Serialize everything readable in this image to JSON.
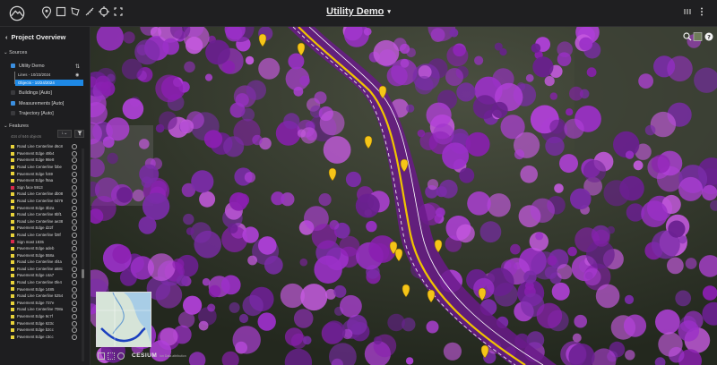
{
  "header": {
    "title": "Utility Demo",
    "caret": "▾",
    "tools": [
      "pin-icon",
      "square-icon",
      "polygon-icon",
      "ruler-icon",
      "crosshair-icon",
      "fullscreen-icon"
    ]
  },
  "sidebar": {
    "back": "‹",
    "project_title": "Project Overview",
    "sources_label": "Sources",
    "source": {
      "name": "Utility Demo",
      "children": [
        "Lines - 10/23/2024",
        "Objects - 10/24/2024"
      ]
    },
    "other_sources": [
      "Buildings [Auto]",
      "Measurements [Auto]",
      "Trajectory [Auto]"
    ],
    "features_label": "Features",
    "features_count": "434 of 646 objects",
    "features": [
      {
        "label": "Road Line Centerline d6c8",
        "color": "#e8d23a"
      },
      {
        "label": "Pavement Edge 49b4",
        "color": "#e8d23a"
      },
      {
        "label": "Pavement Edge 98e8",
        "color": "#e8d23a"
      },
      {
        "label": "Road Line Centerline f2be",
        "color": "#e8d23a"
      },
      {
        "label": "Pavement Edge fc69",
        "color": "#e8d23a"
      },
      {
        "label": "Pavement Edge f9aa",
        "color": "#e8d23a"
      },
      {
        "label": "Sign face 5913",
        "color": "#d9284d"
      },
      {
        "label": "Road Line Centerline db08",
        "color": "#e8d23a"
      },
      {
        "label": "Road Line Centerline 0d79",
        "color": "#e8d23a"
      },
      {
        "label": "Pavement Edge 3b2a",
        "color": "#e8d23a"
      },
      {
        "label": "Road Line Centerline 8bf1",
        "color": "#e8d23a"
      },
      {
        "label": "Road Line Centerline ae38",
        "color": "#e8d23a"
      },
      {
        "label": "Pavement Edge d22f",
        "color": "#e8d23a"
      },
      {
        "label": "Road Line Centerline f28f",
        "color": "#e8d23a"
      },
      {
        "label": "Sign mast 1835",
        "color": "#d9284d"
      },
      {
        "label": "Pavement Edge adeb",
        "color": "#e8d23a"
      },
      {
        "label": "Pavement Edge 558a",
        "color": "#e8d23a"
      },
      {
        "label": "Road Line Centerline 4f4a",
        "color": "#e8d23a"
      },
      {
        "label": "Road Line Centerline a58c",
        "color": "#e8d23a"
      },
      {
        "label": "Pavement Edge c4a7",
        "color": "#e8d23a"
      },
      {
        "label": "Road Line Centerline 0fe4",
        "color": "#e8d23a"
      },
      {
        "label": "Pavement Edge 1485",
        "color": "#e8d23a"
      },
      {
        "label": "Road Line Centerline 5254",
        "color": "#e8d23a"
      },
      {
        "label": "Pavement Edge 737e",
        "color": "#e8d23a"
      },
      {
        "label": "Road Line Centerline 708a",
        "color": "#e8d23a"
      },
      {
        "label": "Pavement Edge 9c7f",
        "color": "#e8d23a"
      },
      {
        "label": "Pavement Edge 623c",
        "color": "#e8d23a"
      },
      {
        "label": "Pavement Edge b2cc",
        "color": "#e8d23a"
      },
      {
        "label": "Pavement Edge c3cc",
        "color": "#e8d23a"
      }
    ]
  },
  "map": {
    "attribution": "CESIUM",
    "attribution_sub": "ion  Data attribution",
    "point_color": "#a020c8",
    "road_color": "#f0c400",
    "marker_color": "#f5c518"
  }
}
